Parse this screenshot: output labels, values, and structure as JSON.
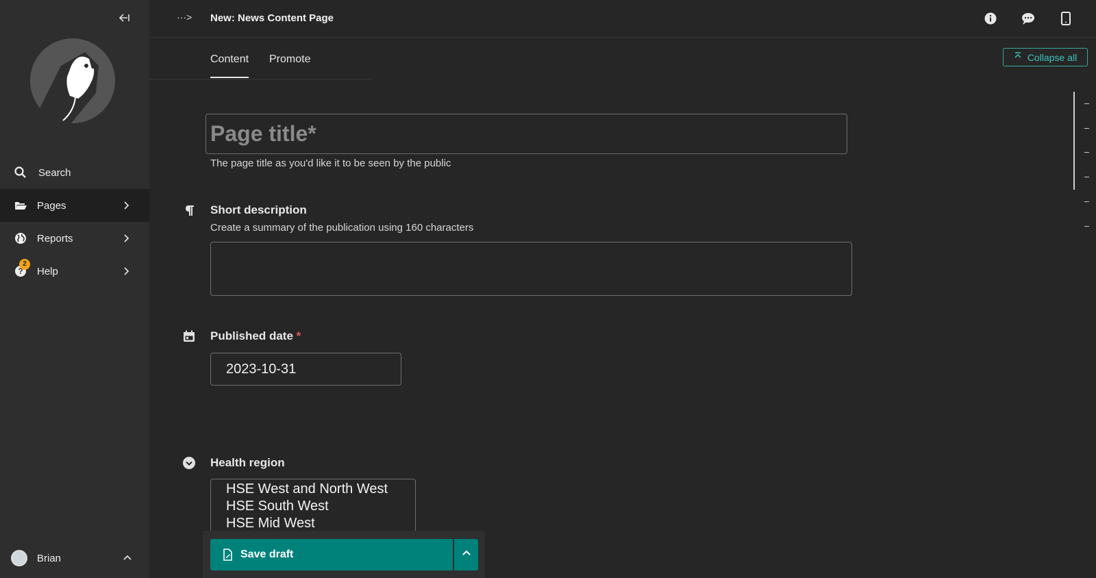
{
  "header": {
    "title": "New: News Content Page",
    "breadcrumb_toggle": "···>"
  },
  "sidebar": {
    "collapse_icon": "collapse-left-icon",
    "items": [
      {
        "label": "Search",
        "icon": "search-icon"
      },
      {
        "label": "Pages",
        "icon": "folder-open-icon",
        "active": true
      },
      {
        "label": "Reports",
        "icon": "globe-icon"
      },
      {
        "label": "Help",
        "icon": "help-icon",
        "badge": "2"
      }
    ],
    "user": {
      "name": "Brian"
    }
  },
  "tabs": [
    {
      "label": "Content",
      "active": true
    },
    {
      "label": "Promote"
    }
  ],
  "collapse_all": "Collapse all",
  "form": {
    "title_placeholder": "Page title*",
    "title_help": "The page title as you'd like it to be seen by the public",
    "short_description": {
      "label": "Short description",
      "help": "Create a summary of the publication using 160 characters",
      "value": ""
    },
    "published_date": {
      "label": "Published date",
      "required_mark": "*",
      "value": "2023-10-31"
    },
    "health_region": {
      "label": "Health region",
      "options": [
        "HSE West and North West",
        "HSE South West",
        "HSE Mid West"
      ]
    }
  },
  "save": {
    "label": "Save draft"
  },
  "colors": {
    "accent": "#00827b",
    "accent_text": "#3fc5bc",
    "badge": "#f0a41b",
    "required": "#e05a5a"
  }
}
